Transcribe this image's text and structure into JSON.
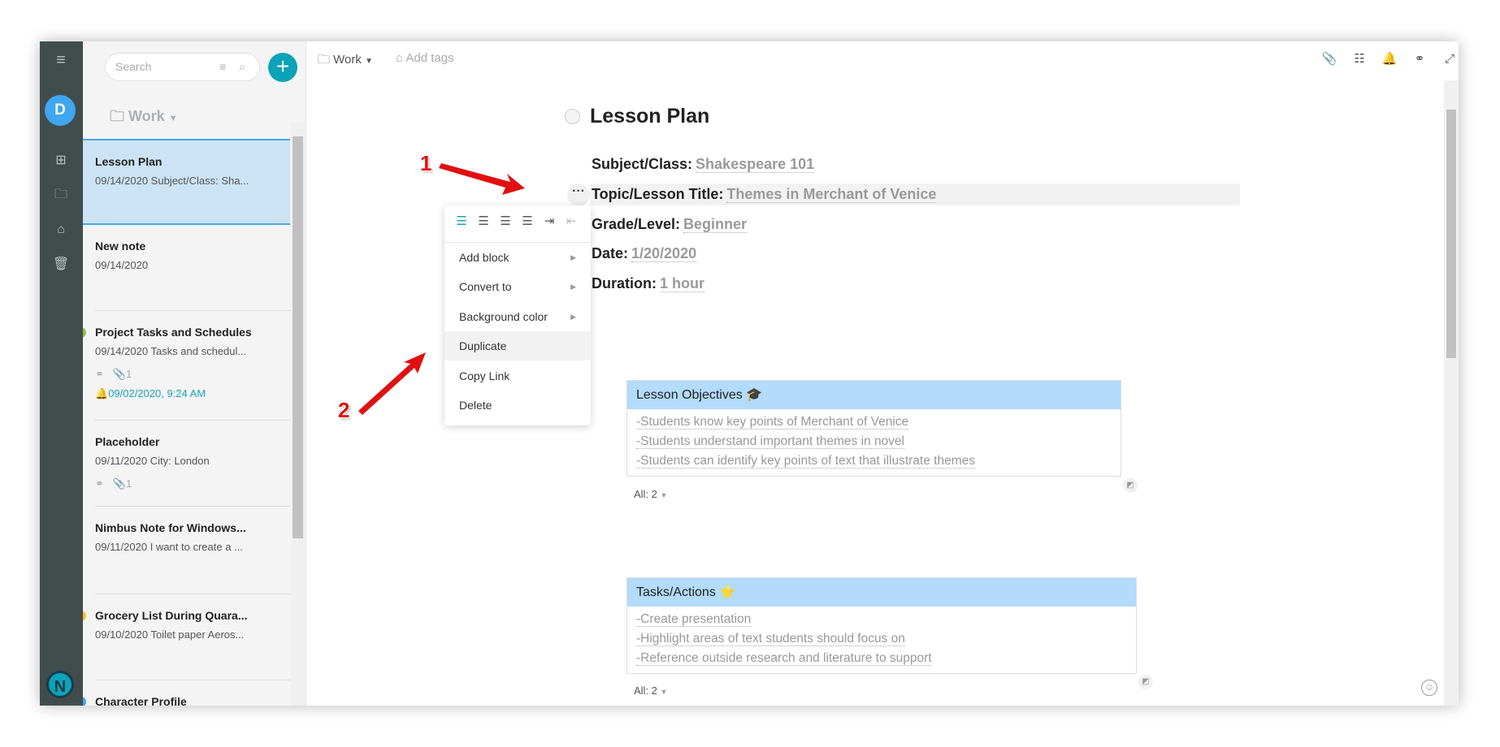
{
  "sidebar": {
    "avatar_letter": "D",
    "icons": [
      "menu-icon",
      "grid-icon",
      "folder-icon",
      "tag-icon",
      "trash-icon"
    ],
    "logo_letter": "N"
  },
  "notelist": {
    "search_placeholder": "Search",
    "folder": "Work",
    "items": [
      {
        "title": "Lesson Plan",
        "snippet": "09/14/2020 Subject/Class: Sha...",
        "selected": true
      },
      {
        "title": "New note",
        "snippet": "09/14/2020"
      },
      {
        "title": "Project Tasks and Schedules",
        "snippet": "09/14/2020 Tasks and schedul...",
        "color": "#8bc34a",
        "attachments": "1",
        "reminder": "09/02/2020, 9:24 AM"
      },
      {
        "title": "Placeholder",
        "snippet": "09/11/2020 City: London",
        "attachments": "1"
      },
      {
        "title": "Nimbus Note for Windows...",
        "snippet": "09/11/2020 I want to create a ..."
      },
      {
        "title": "Grocery List During Quara...",
        "snippet": "09/10/2020 Toilet paper Aeros...",
        "color": "#fbc02d"
      },
      {
        "title": "Character Profile",
        "snippet": "",
        "color": "#42a5f5"
      }
    ]
  },
  "editor": {
    "folder": "Work",
    "add_tags": "Add tags",
    "title": "Lesson Plan",
    "fields": [
      {
        "label": "Subject/Class:",
        "value": "Shakespeare 101"
      },
      {
        "label": "Topic/Lesson Title:",
        "value": "Themes in Merchant of Venice"
      },
      {
        "label": "Grade/Level:",
        "value": "Beginner"
      },
      {
        "label": "Date:",
        "value": "1/20/2020"
      },
      {
        "label": "Duration:",
        "value": "1 hour"
      }
    ],
    "menu": {
      "items": [
        "Add block",
        "Convert to",
        "Background color",
        "Duplicate",
        "Copy Link",
        "Delete"
      ]
    },
    "tables": [
      {
        "header": "Lesson Objectives 🎓",
        "rows": [
          "-Students know key points of Merchant of Venice",
          "-Students understand important themes in novel",
          "-Students can identify key points of text that illustrate themes"
        ],
        "footer": "All: 2"
      },
      {
        "header": "Tasks/Actions ⭐",
        "rows": [
          "-Create presentation",
          "-Highlight areas of text students should focus on",
          "-Reference outside research and literature to support"
        ],
        "footer": "All: 2"
      }
    ]
  },
  "annotations": [
    "1",
    "2"
  ],
  "colors": {
    "accent": "#0aa3b8",
    "rail": "#414d4d",
    "selected": "#cce3f5",
    "table_header": "#b3dbfb",
    "arrow": "#e01010"
  }
}
